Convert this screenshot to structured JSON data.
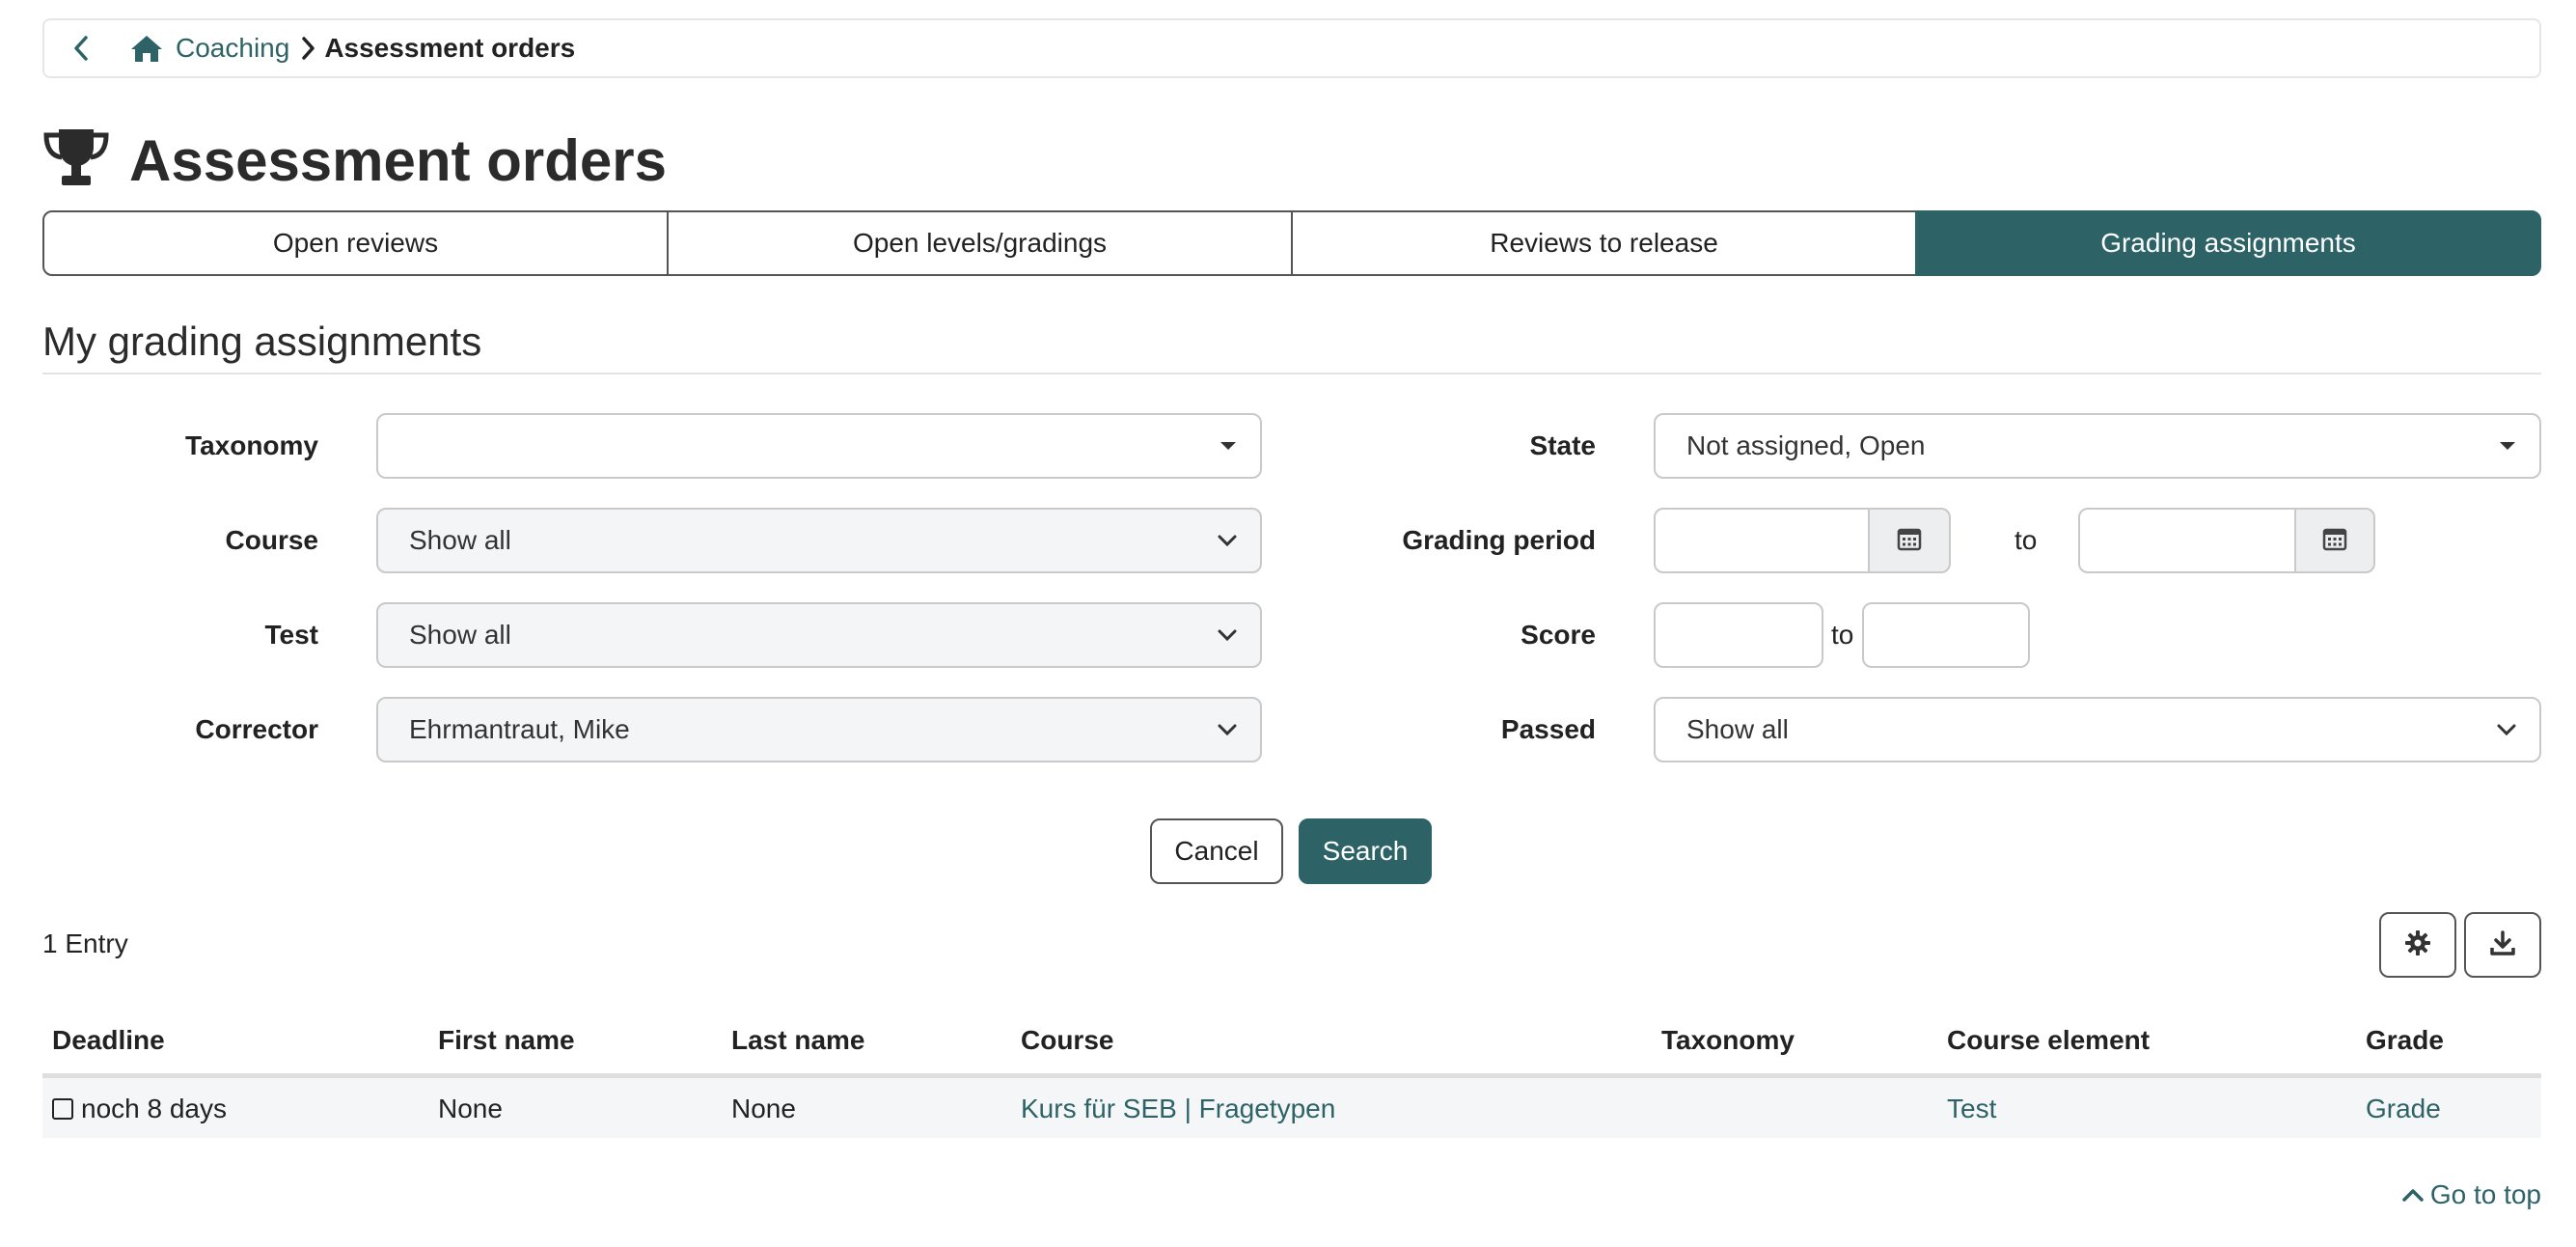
{
  "breadcrumb": {
    "back_icon": "chevron-left-icon",
    "home_icon": "home-icon",
    "parent": "Coaching",
    "current": "Assessment orders"
  },
  "page": {
    "icon": "trophy-icon",
    "title": "Assessment orders"
  },
  "tabs": [
    {
      "label": "Open reviews",
      "active": false
    },
    {
      "label": "Open levels/gradings",
      "active": false
    },
    {
      "label": "Reviews to release",
      "active": false
    },
    {
      "label": "Grading assignments",
      "active": true
    }
  ],
  "section": {
    "title": "My grading assignments"
  },
  "filters": {
    "taxonomy": {
      "label": "Taxonomy",
      "value": ""
    },
    "course": {
      "label": "Course",
      "value": "Show all"
    },
    "test": {
      "label": "Test",
      "value": "Show all"
    },
    "corrector": {
      "label": "Corrector",
      "value": "Ehrmantraut, Mike"
    },
    "state": {
      "label": "State",
      "value": "Not assigned, Open"
    },
    "grading_period": {
      "label": "Grading period",
      "from": "",
      "to": "",
      "separator": "to"
    },
    "score": {
      "label": "Score",
      "from": "",
      "to": "",
      "separator": "to"
    },
    "passed": {
      "label": "Passed",
      "value": "Show all"
    }
  },
  "actions": {
    "cancel": "Cancel",
    "search": "Search"
  },
  "results": {
    "count_text": "1 Entry",
    "settings_icon": "gear-icon",
    "download_icon": "download-icon"
  },
  "table": {
    "columns": [
      "Deadline",
      "First name",
      "Last name",
      "Course",
      "Taxonomy",
      "Course element",
      "Grade"
    ],
    "rows": [
      {
        "deadline": "noch 8 days",
        "first_name": "None",
        "last_name": "None",
        "course": "Kurs für SEB | Fragetypen",
        "taxonomy": "",
        "course_element": "Test",
        "grade": "Grade"
      }
    ]
  },
  "footer": {
    "go_to_top": "Go to top"
  },
  "colors": {
    "accent": "#2d6367",
    "border": "#c9c9c9",
    "row_bg": "#f5f6f7"
  }
}
